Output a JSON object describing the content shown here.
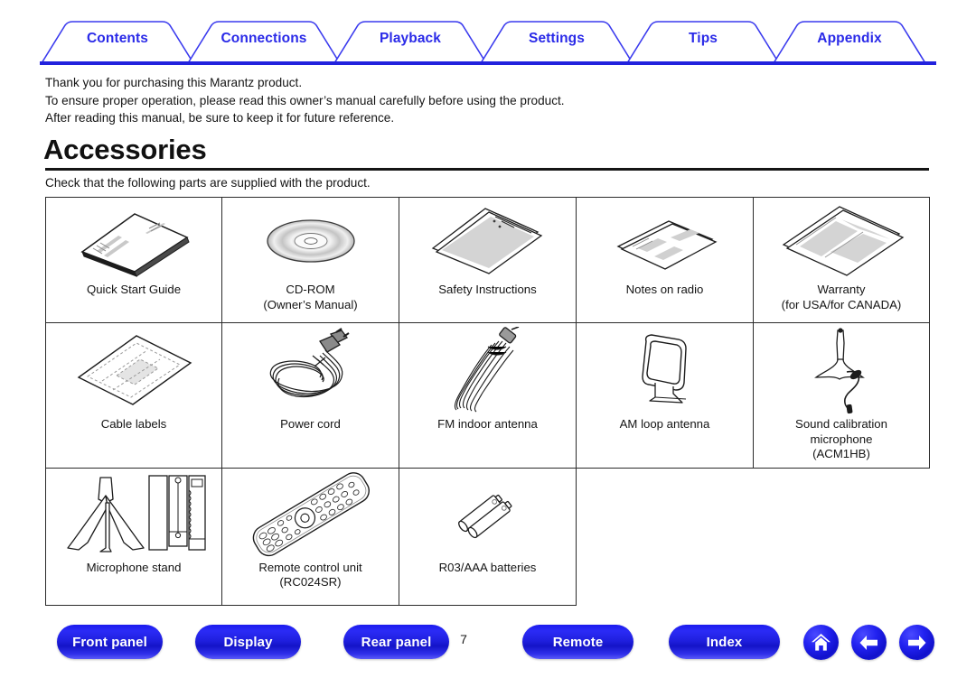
{
  "tabs": [
    {
      "label": "Contents"
    },
    {
      "label": "Connections"
    },
    {
      "label": "Playback"
    },
    {
      "label": "Settings"
    },
    {
      "label": "Tips"
    },
    {
      "label": "Appendix"
    }
  ],
  "intro": {
    "line1": "Thank you for purchasing this Marantz product.",
    "line2": "To ensure proper operation, please read this owner’s manual carefully before using the product.",
    "line3": "After reading this manual, be sure to keep it for future reference."
  },
  "heading": "Accessories",
  "subtext": "Check that the following parts are supplied with the product.",
  "table": {
    "rows": [
      [
        {
          "art": "booklet",
          "caption": "Quick Start Guide"
        },
        {
          "art": "cd",
          "caption": "CD-ROM\n(Owner’s Manual)"
        },
        {
          "art": "safety-sheets",
          "caption": "Safety Instructions"
        },
        {
          "art": "radio-sheet",
          "caption": "Notes on radio"
        },
        {
          "art": "warranty-sheets",
          "caption": "Warranty\n(for USA/for CANADA)"
        }
      ],
      [
        {
          "art": "cable-label-sheet",
          "caption": "Cable labels"
        },
        {
          "art": "power-cord",
          "caption": "Power cord"
        },
        {
          "art": "fm-antenna",
          "caption": "FM indoor antenna"
        },
        {
          "art": "am-loop-antenna",
          "caption": "AM loop antenna"
        },
        {
          "art": "calibration-mic",
          "caption": "Sound calibration\nmicrophone\n(ACM1HB)"
        }
      ],
      [
        {
          "art": "mic-stand",
          "caption": "Microphone stand"
        },
        {
          "art": "remote-control",
          "caption": "Remote control unit\n(RC024SR)"
        },
        {
          "art": "batteries",
          "caption": "R03/AAA batteries"
        },
        {
          "art": "",
          "caption": ""
        },
        {
          "art": "",
          "caption": ""
        }
      ]
    ]
  },
  "footer": {
    "buttons": [
      {
        "label": "Front panel"
      },
      {
        "label": "Display"
      },
      {
        "label": "Rear panel"
      },
      {
        "label": "Remote"
      },
      {
        "label": "Index"
      }
    ],
    "page_number": "7",
    "icons": [
      {
        "name": "home-icon"
      },
      {
        "name": "back-arrow-icon"
      },
      {
        "name": "forward-arrow-icon"
      }
    ]
  },
  "colors": {
    "tab_text": "#2a2ae8",
    "tab_outline": "#3a3aee",
    "rule": "#2222dd",
    "button_blue": "#1f1fe0",
    "body_text": "#141414"
  }
}
